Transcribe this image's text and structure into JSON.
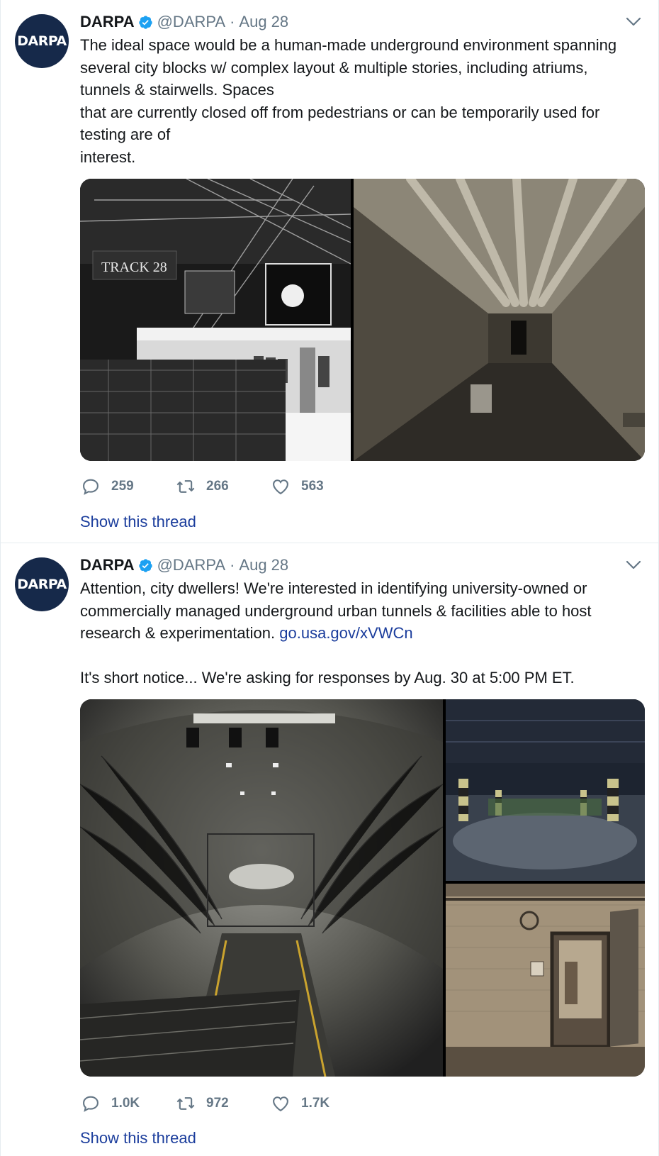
{
  "tweets": [
    {
      "avatar_text": "DARPA",
      "name": "DARPA",
      "handle": "@DARPA",
      "separator": "·",
      "date": "Aug 28",
      "text": "The ideal space would be a human-made underground environment spanning several city blocks w/ complex layout & multiple stories, including atriums, tunnels & stairwells. Spaces\nthat are currently closed off from pedestrians or can be temporarily used for testing are of\ninterest.",
      "media": [
        {
          "description": "train-platform-track-28",
          "sign_text": "TRACK 28"
        },
        {
          "description": "underground-corridor-with-pipes"
        }
      ],
      "replies": "259",
      "retweets": "266",
      "likes": "563",
      "thread_label": "Show this thread"
    },
    {
      "avatar_text": "DARPA",
      "name": "DARPA",
      "handle": "@DARPA",
      "separator": "·",
      "date": "Aug 28",
      "text_before_link": "Attention, city dwellers! We're interested in identifying university-owned or commercially managed underground urban tunnels & facilities able to host research & experimentation. ",
      "link": "go.usa.gov/xVWCn",
      "text_after": "It's short notice... We're asking for responses by Aug. 30 at 5:00 PM ET.",
      "media": [
        {
          "description": "subway-station-escalator-tunnel"
        },
        {
          "description": "underground-parking-garage"
        },
        {
          "description": "bunker-room-with-doorway"
        }
      ],
      "replies": "1.0K",
      "retweets": "972",
      "likes": "1.7K",
      "thread_label": "Show this thread"
    }
  ],
  "colors": {
    "avatar_bg": "#16294a",
    "link": "#1b3d9c",
    "muted": "#657786",
    "verified": "#1da1f2"
  },
  "icons": [
    "verified-badge-icon",
    "caret-down-icon",
    "reply-icon",
    "retweet-icon",
    "like-icon"
  ]
}
